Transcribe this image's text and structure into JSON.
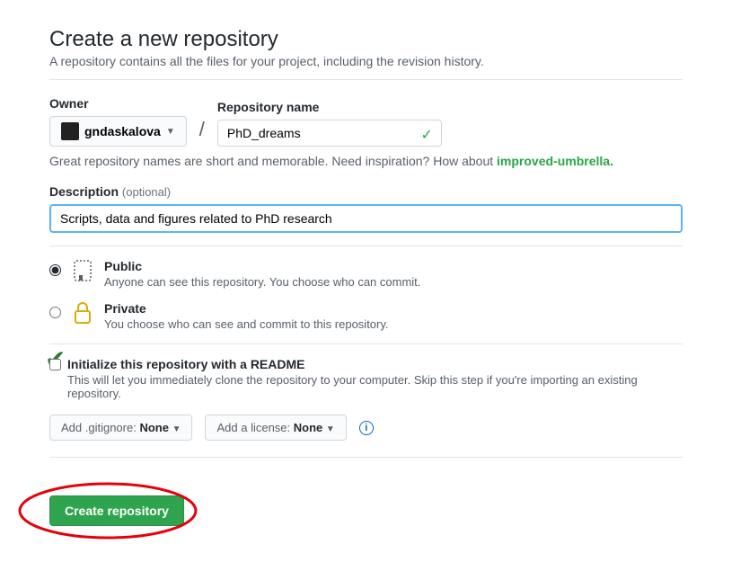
{
  "header": {
    "title": "Create a new repository",
    "subtitle": "A repository contains all the files for your project, including the revision history."
  },
  "owner": {
    "label": "Owner",
    "username": "gndaskalova"
  },
  "repo": {
    "label": "Repository name",
    "value": "PhD_dreams"
  },
  "hint": {
    "prefix": "Great repository names are short and memorable. Need inspiration? How about",
    "suggestion": "improved-umbrella."
  },
  "description": {
    "label": "Description",
    "optional": "(optional)",
    "value": "Scripts, data and figures related to PhD research"
  },
  "visibility": {
    "public": {
      "title": "Public",
      "desc": "Anyone can see this repository. You choose who can commit."
    },
    "private": {
      "title": "Private",
      "desc": "You choose who can see and commit to this repository."
    }
  },
  "readme": {
    "title": "Initialize this repository with a README",
    "desc": "This will let you immediately clone the repository to your computer. Skip this step if you're importing an existing repository."
  },
  "dropdowns": {
    "gitignore_prefix": "Add .gitignore: ",
    "gitignore_value": "None",
    "license_prefix": "Add a license: ",
    "license_value": "None"
  },
  "submit": {
    "label": "Create repository"
  }
}
